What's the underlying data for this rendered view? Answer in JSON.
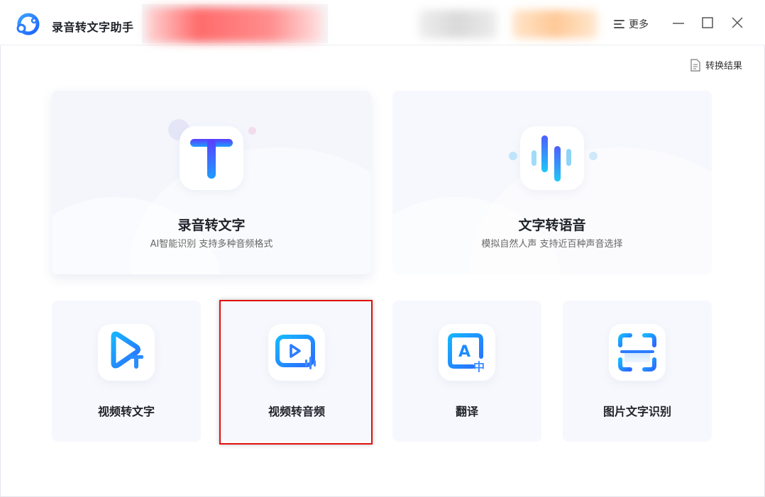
{
  "app": {
    "title": "录音转文字助手"
  },
  "header": {
    "more_label": "更多"
  },
  "toolbar": {
    "result_label": "转换结果"
  },
  "features": {
    "big": [
      {
        "title": "录音转文字",
        "subtitle": "AI智能识别 支持多种音频格式",
        "icon": "text-T-icon"
      },
      {
        "title": "文字转语音",
        "subtitle": "模拟自然人声 支持近百种声音选择",
        "icon": "sound-wave-icon"
      }
    ],
    "small": [
      {
        "title": "视频转文字",
        "icon": "video-to-text-icon"
      },
      {
        "title": "视频转音频",
        "icon": "video-to-audio-icon"
      },
      {
        "title": "翻译",
        "icon": "translate-icon"
      },
      {
        "title": "图片文字识别",
        "icon": "image-ocr-icon"
      }
    ]
  },
  "colors": {
    "accent": "#1e7bff",
    "highlight": "#e01010"
  }
}
